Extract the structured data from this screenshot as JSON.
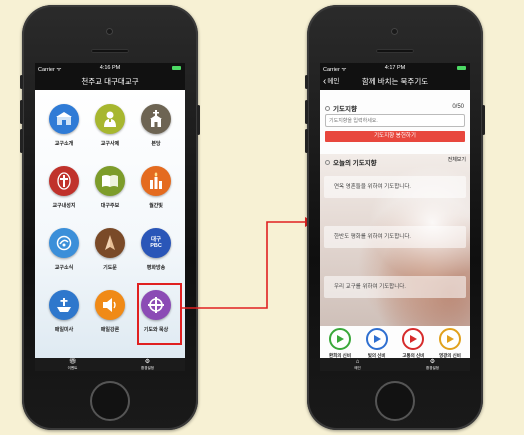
{
  "status": {
    "carrier": "Carrier ᯤ",
    "time_left": "4:16 PM",
    "time_right": "4:17 PM"
  },
  "left": {
    "title": "천주교 대구대교구",
    "menu": [
      {
        "label": "교구소개",
        "icon": "church-building-icon",
        "color": "#2f7bd6"
      },
      {
        "label": "교구사제",
        "icon": "priest-icon",
        "color": "#a7b72f"
      },
      {
        "label": "본당",
        "icon": "chapel-icon",
        "color": "#6d6453"
      },
      {
        "label": "교구내성지",
        "icon": "cross-shrine-icon",
        "color": "#c0322b"
      },
      {
        "label": "대구주보",
        "icon": "book-icon",
        "color": "#7d9c2a"
      },
      {
        "label": "월간빛",
        "icon": "candles-icon",
        "color": "#e46b1f"
      },
      {
        "label": "교구소식",
        "icon": "news-icon",
        "color": "#3b8fd9"
      },
      {
        "label": "기도문",
        "icon": "praying-hands-icon",
        "color": "#7a4a28"
      },
      {
        "label": "평화방송",
        "icon": "broadcast-icon",
        "color": "#2a56b8",
        "text": "대구 PBC"
      },
      {
        "label": "매일미사",
        "icon": "mass-icon",
        "color": "#2e77cc"
      },
      {
        "label": "매일강론",
        "icon": "speaker-icon",
        "color": "#f08a17"
      },
      {
        "label": "기도와 묵상",
        "icon": "cross-target-icon",
        "color": "#8b4bb5"
      }
    ],
    "tabs": [
      {
        "label": "이벤트",
        "icon": "gift-icon"
      },
      {
        "label": "환경설정",
        "icon": "gear-icon"
      }
    ]
  },
  "right": {
    "back_label": "메인",
    "title": "함께 바치는 묵주기도",
    "intent_title": "기도지향",
    "counter": "0/50",
    "input_placeholder": "기도지향을 입력하세요.",
    "offer_button": "기도지향 봉헌하기",
    "today_title": "오늘의 기도지향",
    "see_all": "전체보기",
    "intentions": [
      "연옥 영혼들을 위하여 기도합니다.",
      "한반도 평화를 위하여 기도합니다.",
      "우리 교구를 위하여 기도합니다."
    ],
    "mysteries": [
      {
        "label": "환희의 신비",
        "color": "#3aa83a"
      },
      {
        "label": "빛의 신비",
        "color": "#2f6fd0"
      },
      {
        "label": "고통의 신비",
        "color": "#d62b2b"
      },
      {
        "label": "영광의 신비",
        "color": "#e0a11d"
      }
    ],
    "tabs": [
      {
        "label": "메인",
        "icon": "home-icon"
      },
      {
        "label": "환경설정",
        "icon": "gear-icon"
      }
    ]
  },
  "colors": {
    "highlight": "#e02020",
    "offer_button": "#e8473d",
    "background": "#f7f1d4"
  }
}
